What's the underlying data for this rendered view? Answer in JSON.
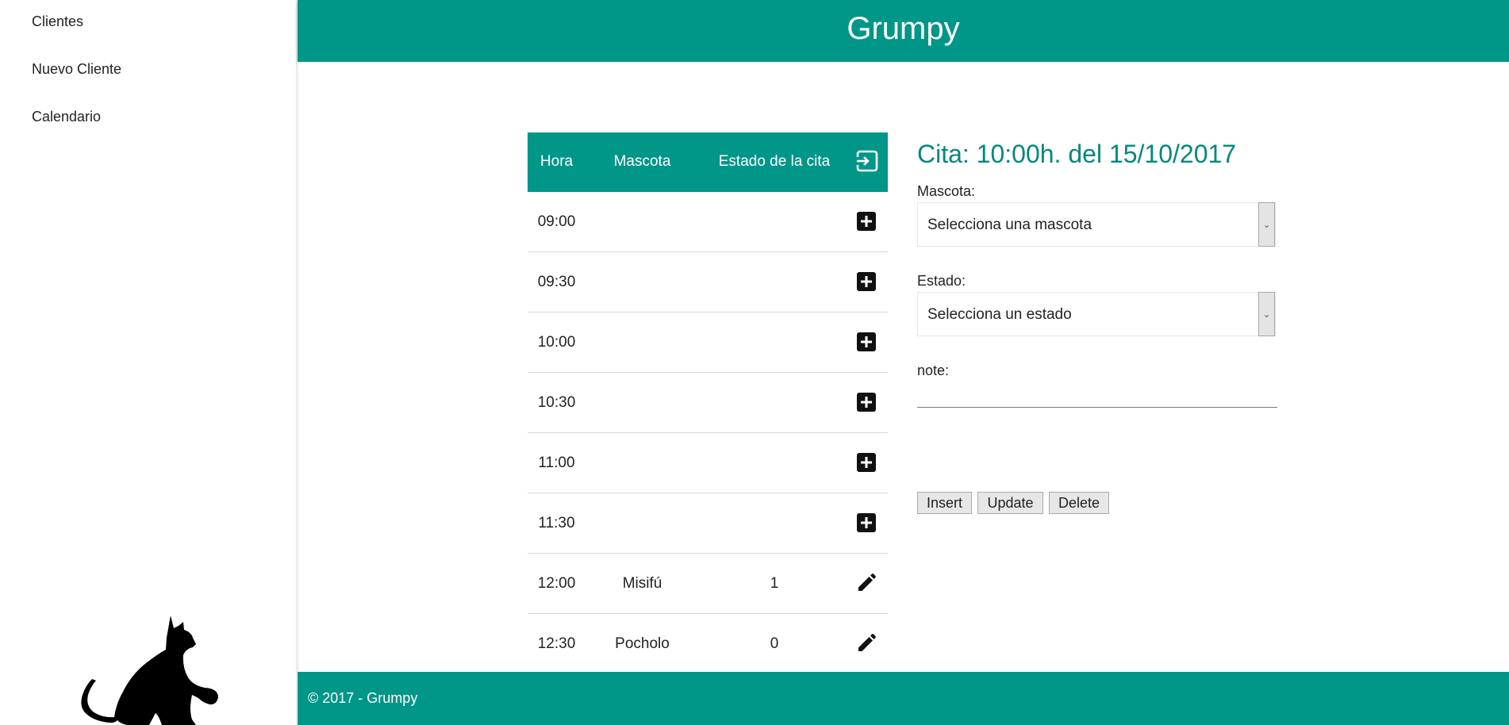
{
  "app": {
    "title": "Grumpy"
  },
  "sidebar": {
    "items": [
      {
        "label": "Clientes"
      },
      {
        "label": "Nuevo Cliente"
      },
      {
        "label": "Calendario"
      }
    ]
  },
  "table": {
    "headers": {
      "hora": "Hora",
      "mascota": "Mascota",
      "estado": "Estado de la cita"
    },
    "header_icon": "exit-to-app-icon",
    "rows": [
      {
        "hora": "09:00",
        "mascota": "",
        "estado": "",
        "action": "add-box-icon"
      },
      {
        "hora": "09:30",
        "mascota": "",
        "estado": "",
        "action": "add-box-icon"
      },
      {
        "hora": "10:00",
        "mascota": "",
        "estado": "",
        "action": "add-box-icon"
      },
      {
        "hora": "10:30",
        "mascota": "",
        "estado": "",
        "action": "add-box-icon"
      },
      {
        "hora": "11:00",
        "mascota": "",
        "estado": "",
        "action": "add-box-icon"
      },
      {
        "hora": "11:30",
        "mascota": "",
        "estado": "",
        "action": "add-box-icon"
      },
      {
        "hora": "12:00",
        "mascota": "Misifú",
        "estado": "1",
        "action": "edit-pencil-icon"
      },
      {
        "hora": "12:30",
        "mascota": "Pocholo",
        "estado": "0",
        "action": "edit-pencil-icon"
      }
    ]
  },
  "form": {
    "title": "Cita: 10:00h. del 15/10/2017",
    "mascota_label": "Mascota:",
    "mascota_value": "Selecciona una mascota",
    "estado_label": "Estado:",
    "estado_value": "Selecciona un estado",
    "note_label": "note:",
    "note_value": "",
    "insert_label": "Insert",
    "update_label": "Update",
    "delete_label": "Delete"
  },
  "footer": {
    "text": "© 2017 - Grumpy"
  },
  "colors": {
    "primary": "#009688",
    "title_accent": "#00897b"
  }
}
